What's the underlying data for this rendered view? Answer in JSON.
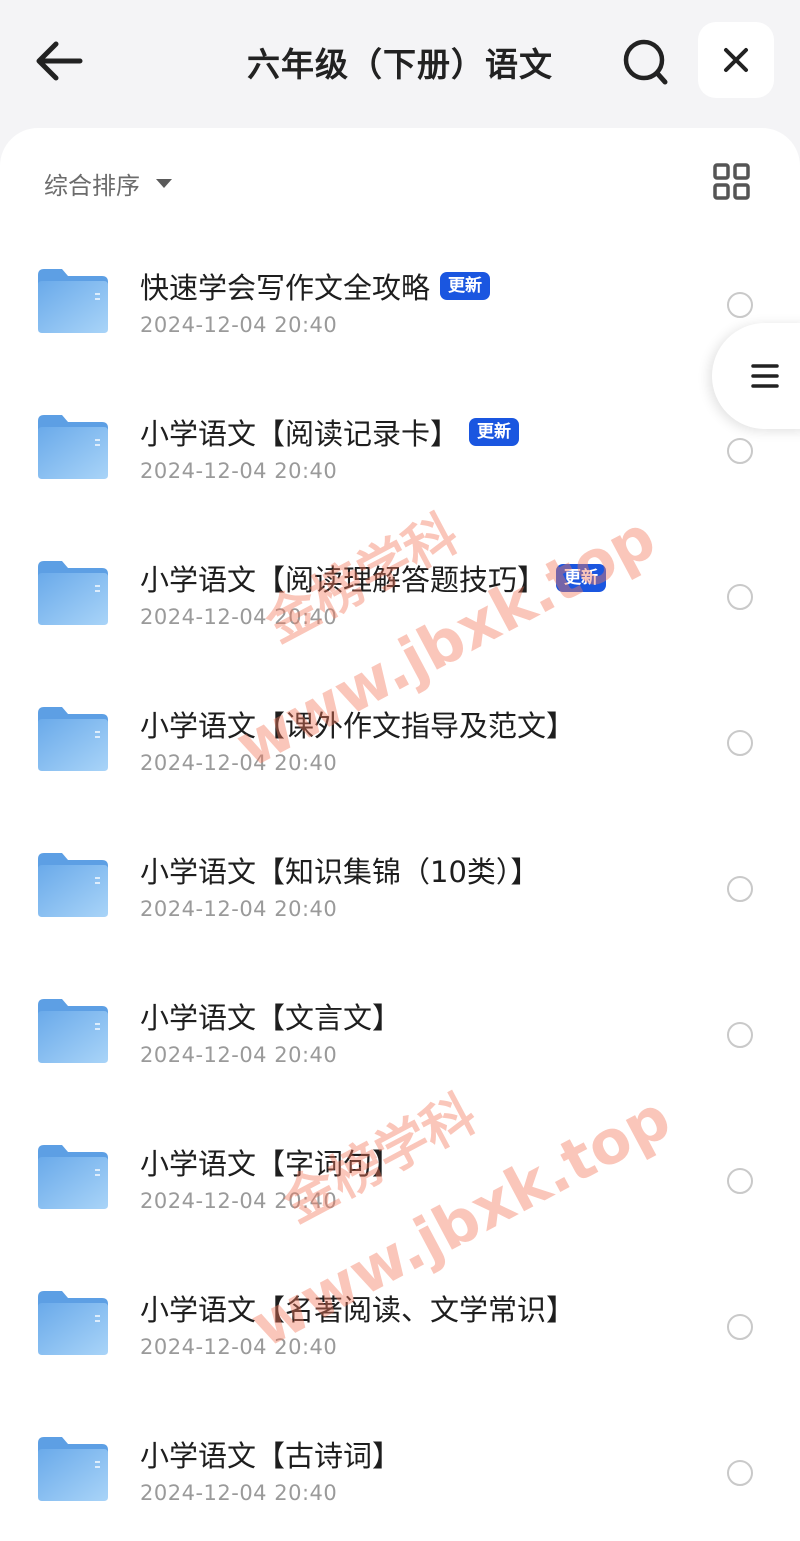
{
  "header": {
    "title": "六年级（下册）语文",
    "back_icon": "arrow-left-icon",
    "search_icon": "search-icon",
    "close_icon": "close-icon"
  },
  "toolbar": {
    "sort_label": "综合排序",
    "sort_icon": "caret-down-icon",
    "view_icon": "grid-view-icon"
  },
  "side_handle_icon": "menu-icon",
  "items": [
    {
      "title": "快速学会写作文全攻略",
      "badge": "更新",
      "date": "2024-12-04 20:40"
    },
    {
      "title": "小学语文【阅读记录卡】",
      "badge": "更新",
      "date": "2024-12-04 20:40"
    },
    {
      "title": "小学语文【阅读理解答题技巧】",
      "badge": "更新",
      "date": "2024-12-04 20:40"
    },
    {
      "title": "小学语文【课外作文指导及范文】",
      "badge": "",
      "date": "2024-12-04 20:40"
    },
    {
      "title": "小学语文【知识集锦（10类）】",
      "badge": "",
      "date": "2024-12-04 20:40"
    },
    {
      "title": "小学语文【文言文】",
      "badge": "",
      "date": "2024-12-04 20:40"
    },
    {
      "title": "小学语文【字词句】",
      "badge": "",
      "date": "2024-12-04 20:40"
    },
    {
      "title": "小学语文【名著阅读、文学常识】",
      "badge": "",
      "date": "2024-12-04 20:40"
    },
    {
      "title": "小学语文【古诗词】",
      "badge": "",
      "date": "2024-12-04 20:40"
    }
  ],
  "watermark": {
    "line1": "金榜学科",
    "line2": "www.jbxk.top"
  },
  "colors": {
    "badge": "#1a56e0",
    "folder": "#7db8ee",
    "watermark": "#f2785a"
  }
}
